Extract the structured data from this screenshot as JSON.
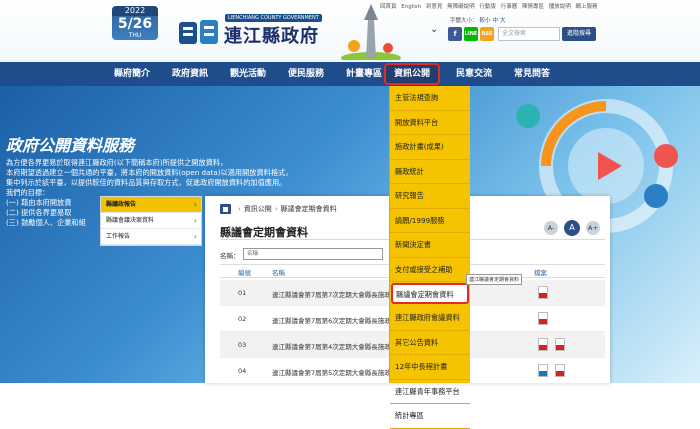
{
  "header": {
    "date_badge": {
      "year": "2022",
      "date": "5/26",
      "weekday": "THU"
    },
    "logo": {
      "english": "LIENCHIANG COUNTY GOVERNMENT",
      "chinese": "連江縣政府"
    },
    "top_links": [
      "回首頁",
      "English",
      "到意見",
      "無障礙說明",
      "行動版",
      "行事曆",
      "陳情專區",
      "播放說明",
      "網上服務"
    ],
    "font_size_label": "字體大小：",
    "font_size_options": [
      "較小",
      "中",
      "大"
    ],
    "social": {
      "facebook": "f",
      "line": "LINE",
      "rss": "RSS"
    },
    "search": {
      "placeholder": "全文檢索",
      "button": "進階搜尋"
    }
  },
  "nav": {
    "items": [
      {
        "label": "縣府簡介"
      },
      {
        "label": "政府資訊"
      },
      {
        "label": "觀光活動"
      },
      {
        "label": "便民服務"
      },
      {
        "label": "計畫專區"
      },
      {
        "label": "資訊公開"
      },
      {
        "label": "民意交流"
      },
      {
        "label": "常見問答"
      }
    ],
    "active": "資訊公開"
  },
  "hero": {
    "title": "政府公開資料服務",
    "lines": [
      "為方便各界更易於取得連江縣政府(以下簡稱本府)所提供之開放資料，",
      "本府期望透過建立一個共通的平臺，將本府的開放資料(open data)以適用開放資料格式，",
      "集中列示於該平臺，以提供較佳的資料品質與存取方式，促進政府開放資料的加值應用。",
      "我們的目標：",
      "(一) 藉由本府開放資",
      "(二) 提供各界更易取",
      "(三) 鼓勵個人、企業和組"
    ]
  },
  "sidebar": {
    "items": [
      {
        "label": "縣議政報告"
      },
      {
        "label": "縣議會議決案資料"
      },
      {
        "label": "工作報告"
      }
    ]
  },
  "content": {
    "breadcrumb": [
      "資訊公開",
      "縣議會定期會資料"
    ],
    "title": "縣議會定期會資料",
    "font_buttons": [
      "A-",
      "A",
      "A+"
    ],
    "filter_label": "名稱：",
    "filter_placeholder": "名稱",
    "columns": {
      "index": "編號",
      "name": "名稱",
      "files": "檔案"
    },
    "rows": [
      {
        "index": "01",
        "name": "連江縣議會第7屆第7次定期大會縣長施政報告",
        "files": [
          "pdf"
        ]
      },
      {
        "index": "02",
        "name": "連江縣議會第7屆第6次定期大會縣長施政報告",
        "files": [
          "pdf"
        ]
      },
      {
        "index": "03",
        "name": "連江縣議會第7屆第4次定期大會縣長施政報告",
        "files": [
          "pdf",
          "pdf"
        ]
      },
      {
        "index": "04",
        "name": "連江縣議會第7屆第5次定期大會縣長施政報告",
        "files": [
          "odt",
          "pdf"
        ]
      }
    ]
  },
  "dropdown": {
    "items": [
      {
        "label": "主管法規查詢"
      },
      {
        "label": "開放資料平台"
      },
      {
        "label": "施政計畫(成果)"
      },
      {
        "label": "縣政統計"
      },
      {
        "label": "研究報告"
      },
      {
        "label": "請願/1999服務"
      },
      {
        "label": "新聞決定書"
      },
      {
        "label": "支付或接受之補助"
      },
      {
        "label": "縣議會定期會資料"
      },
      {
        "label": "連江縣政府會議資料"
      },
      {
        "label": "其它公告資料"
      },
      {
        "label": "12年中長程計畫"
      },
      {
        "label": "連江縣青年事務平台"
      },
      {
        "label": "統計專區"
      }
    ],
    "active": "縣議會定期會資料",
    "tooltip": "連江縣議會定期會資料"
  },
  "colors": {
    "nav_bg": "#1f4d8c",
    "dropdown_bg": "#f5c300",
    "highlight": "#e32a2a"
  }
}
